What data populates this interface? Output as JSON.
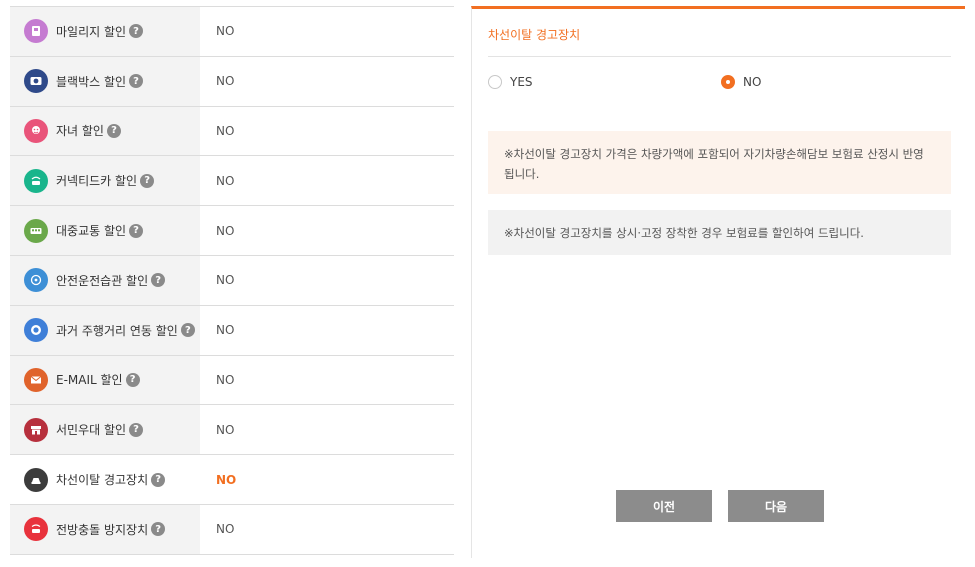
{
  "discounts": {
    "help_symbol": "?",
    "rows": [
      {
        "label": "마일리지 할인",
        "value": "NO",
        "icon": "mileage-icon",
        "color": "#c57bd1"
      },
      {
        "label": "블랙박스 할인",
        "value": "NO",
        "icon": "blackbox-icon",
        "color": "#2f4a8a"
      },
      {
        "label": "자녀 할인",
        "value": "NO",
        "icon": "child-icon",
        "color": "#e9547a"
      },
      {
        "label": "커넥티드카 할인",
        "value": "NO",
        "icon": "connected-car-icon",
        "color": "#19b58c"
      },
      {
        "label": "대중교통 할인",
        "value": "NO",
        "icon": "bus-icon",
        "color": "#6aa84a"
      },
      {
        "label": "안전운전습관 할인",
        "value": "NO",
        "icon": "safe-driving-icon",
        "color": "#3d8fd6"
      },
      {
        "label": "과거 주행거리 연동 할인",
        "value": "NO",
        "icon": "mileage-history-icon",
        "color": "#3f7fd8"
      },
      {
        "label": "E-MAIL 할인",
        "value": "NO",
        "icon": "email-icon",
        "color": "#e0632b"
      },
      {
        "label": "서민우대 할인",
        "value": "NO",
        "icon": "store-icon",
        "color": "#b7303d"
      },
      {
        "label": "차선이탈 경고장치",
        "value": "NO",
        "icon": "lane-departure-icon",
        "color": "#3c3c3c"
      },
      {
        "label": "전방충돌 방지장치",
        "value": "NO",
        "icon": "collision-icon",
        "color": "#e8323c"
      }
    ]
  },
  "panel": {
    "title": "차선이탈 경고장치",
    "options": {
      "yes": "YES",
      "no": "NO"
    },
    "selected": "NO",
    "notice1": "※차선이탈 경고장치 가격은 차량가액에 포함되어 자기차량손해담보 보험료 산정시 반영됩니다.",
    "notice2": "※차선이탈 경고장치를 상시·고정 장착한 경우 보험료를 할인하여 드립니다.",
    "prev_label": "이전",
    "next_label": "다음",
    "accent_color": "#f26f21"
  }
}
